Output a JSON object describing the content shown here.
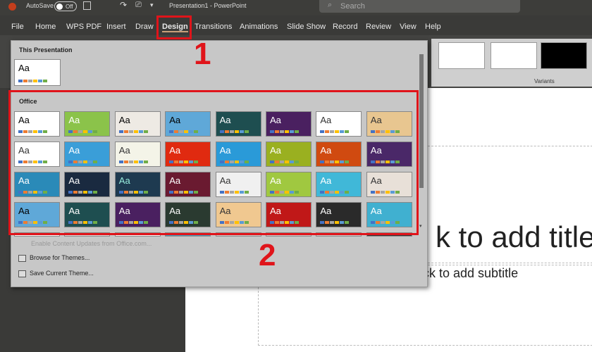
{
  "titlebar": {
    "autosave": "AutoSave",
    "toggle": "Off",
    "title": "Presentation1  -  PowerPoint",
    "search_placeholder": "Search"
  },
  "menu": [
    "File",
    "Home",
    "WPS PDF",
    "Insert",
    "Draw",
    "Design",
    "Transitions",
    "Animations",
    "Slide Show",
    "Record",
    "Review",
    "View",
    "Help"
  ],
  "active_tab": "Design",
  "variants_label": "Variants",
  "panel": {
    "this_presentation": "This Presentation",
    "office": "Office",
    "items": [
      "Enable Content Updates from Office.com...",
      "Browse for Themes...",
      "Save Current Theme..."
    ]
  },
  "annotations": {
    "one": "1",
    "two": "2",
    "accent": "#e0141a"
  },
  "slide": {
    "title": "k to add title",
    "subtitle": "ck to add subtitle"
  },
  "swatches": [
    "#4472c4",
    "#ed7d31",
    "#a5a5a5",
    "#ffc000",
    "#5b9bd5",
    "#70ad47"
  ],
  "themes": [
    {
      "bg": "#ffffff",
      "fg": "#000"
    },
    {
      "bg": "#8bc34a",
      "fg": "#fff"
    },
    {
      "bg": "#eeeae4",
      "fg": "#000"
    },
    {
      "bg": "#5fa8d8",
      "fg": "#000"
    },
    {
      "bg": "#1e4e50",
      "fg": "#fff"
    },
    {
      "bg": "#4a2060",
      "fg": "#fff"
    },
    {
      "bg": "#ffffff",
      "fg": "#333"
    },
    {
      "bg": "#e8c690",
      "fg": "#333"
    },
    {
      "bg": "#ffffff",
      "fg": "#333"
    },
    {
      "bg": "#3a9ed8",
      "fg": "#fff"
    },
    {
      "bg": "#f4f4e8",
      "fg": "#333"
    },
    {
      "bg": "#e02a10",
      "fg": "#fff"
    },
    {
      "bg": "#2a9ad8",
      "fg": "#fff"
    },
    {
      "bg": "#9ab020",
      "fg": "#fff"
    },
    {
      "bg": "#d04a10",
      "fg": "#fff"
    },
    {
      "bg": "#4a2868",
      "fg": "#fff"
    },
    {
      "bg": "#2a8ab8",
      "fg": "#fff"
    },
    {
      "bg": "#1a2a40",
      "fg": "#fff"
    },
    {
      "bg": "#1e3a50",
      "fg": "#9ed"
    },
    {
      "bg": "#6a1a30",
      "fg": "#fff"
    },
    {
      "bg": "#f0f0f0",
      "fg": "#333"
    },
    {
      "bg": "#a0c840",
      "fg": "#fff"
    },
    {
      "bg": "#40b8d8",
      "fg": "#fff"
    },
    {
      "bg": "#e8e0d8",
      "fg": "#333"
    },
    {
      "bg": "#5fa8d8",
      "fg": "#000"
    },
    {
      "bg": "#1e4e50",
      "fg": "#fff"
    },
    {
      "bg": "#4a2060",
      "fg": "#fff"
    },
    {
      "bg": "#2a3a30",
      "fg": "#fff"
    },
    {
      "bg": "#f0c890",
      "fg": "#333"
    },
    {
      "bg": "#c01818",
      "fg": "#fff"
    },
    {
      "bg": "#2a2a2a",
      "fg": "#fff"
    },
    {
      "bg": "#40b0d0",
      "fg": "#fff"
    },
    {
      "bg": "#ffffff",
      "fg": "#333"
    },
    {
      "bg": "#ddd",
      "fg": "#333"
    },
    {
      "bg": "#ffffff",
      "fg": "#333"
    },
    {
      "bg": "#3aa0c0",
      "fg": "#fff"
    },
    {
      "bg": "#ccc",
      "fg": "#333"
    },
    {
      "bg": "#ccc",
      "fg": "#333"
    },
    {
      "bg": "#ccc",
      "fg": "#333"
    },
    {
      "bg": "#333",
      "fg": "#fff"
    }
  ],
  "tile_text": "Aa"
}
